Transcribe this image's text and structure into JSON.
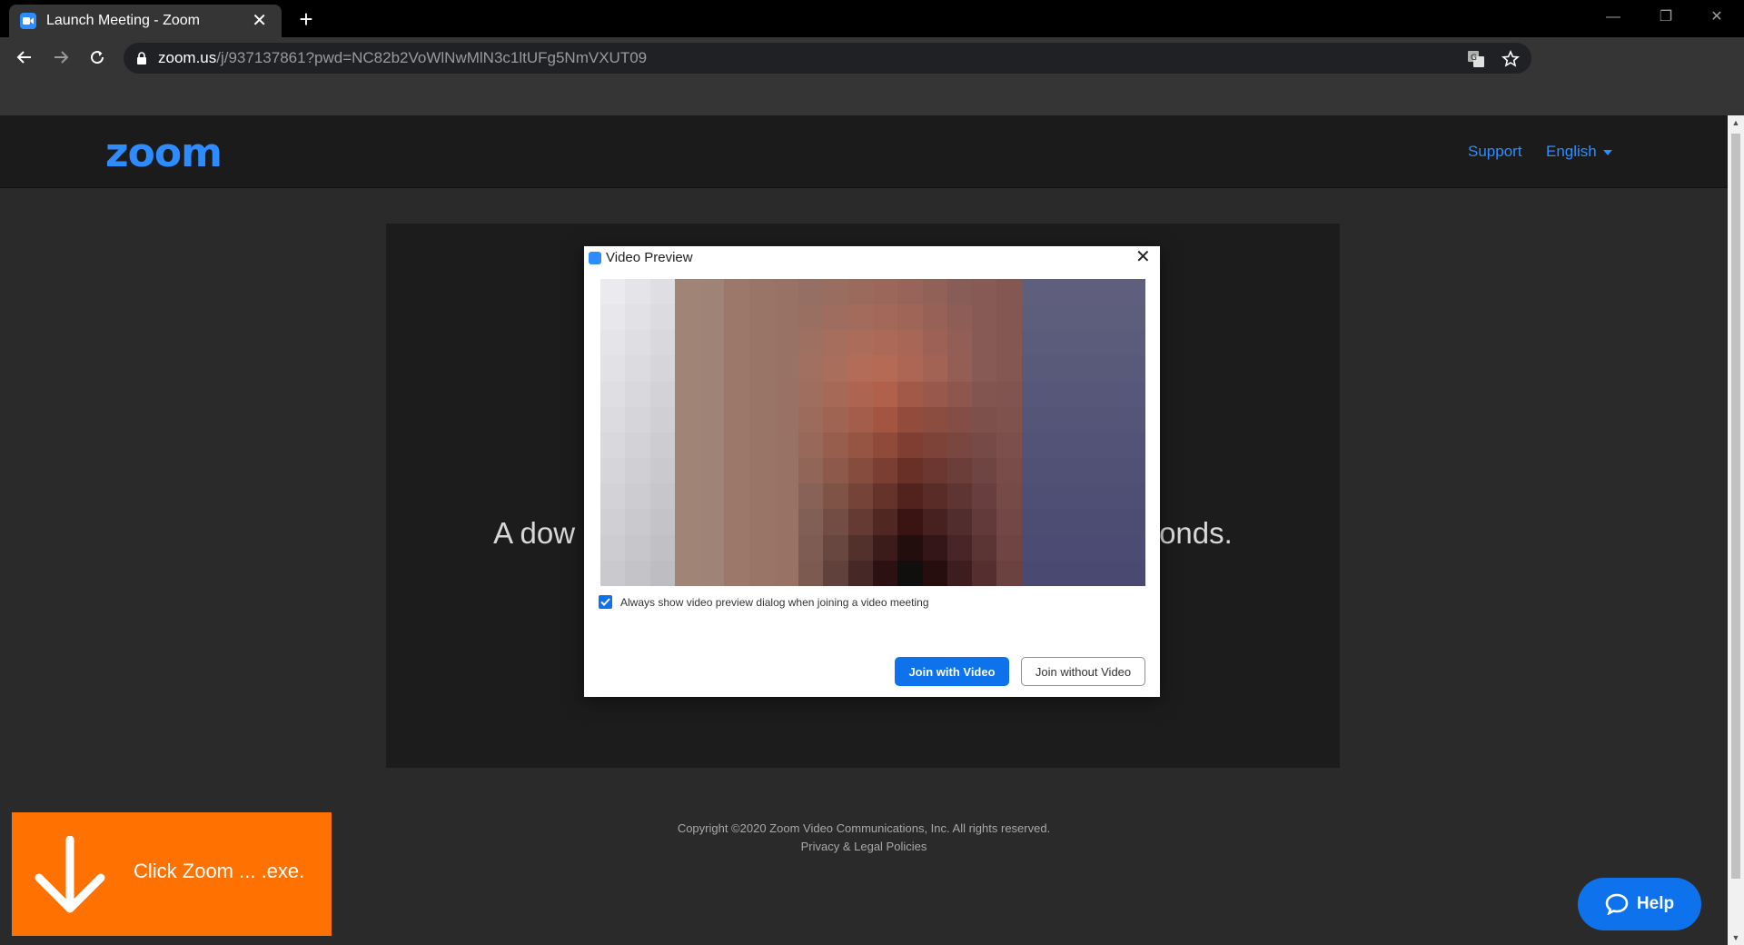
{
  "browser": {
    "tab_title": "Launch Meeting - Zoom",
    "tab_close": "✕",
    "new_tab": "+",
    "window_controls": {
      "minimize": "—",
      "restore": "❐",
      "close": "✕"
    },
    "url_host": "zoom.us",
    "url_path": "/j/937137861?pwd=NC82b2VoWlNwMlN3c1ltUFg5NmVXUT09"
  },
  "header": {
    "logo": "zoom",
    "support": "Support",
    "language": "English"
  },
  "main": {
    "download_message_left": "A dow",
    "download_message_right": "onds."
  },
  "footer": {
    "copyright": "Copyright ©2020 Zoom Video Communications, Inc. All rights reserved.",
    "privacy": "Privacy & Legal Policies"
  },
  "dialog": {
    "title": "Video Preview",
    "close": "✕",
    "checkbox_label": "Always show video preview dialog when joining a video meeting",
    "checkbox_checked": true,
    "join_with_video": "Join with Video",
    "join_without_video": "Join without Video"
  },
  "banner": {
    "text": "Click Zoom ... .exe."
  },
  "help": {
    "label": "Help"
  },
  "colors": {
    "zoom_blue": "#2d8cff",
    "button_blue": "#0e72ed",
    "banner_orange": "#ff7100"
  }
}
